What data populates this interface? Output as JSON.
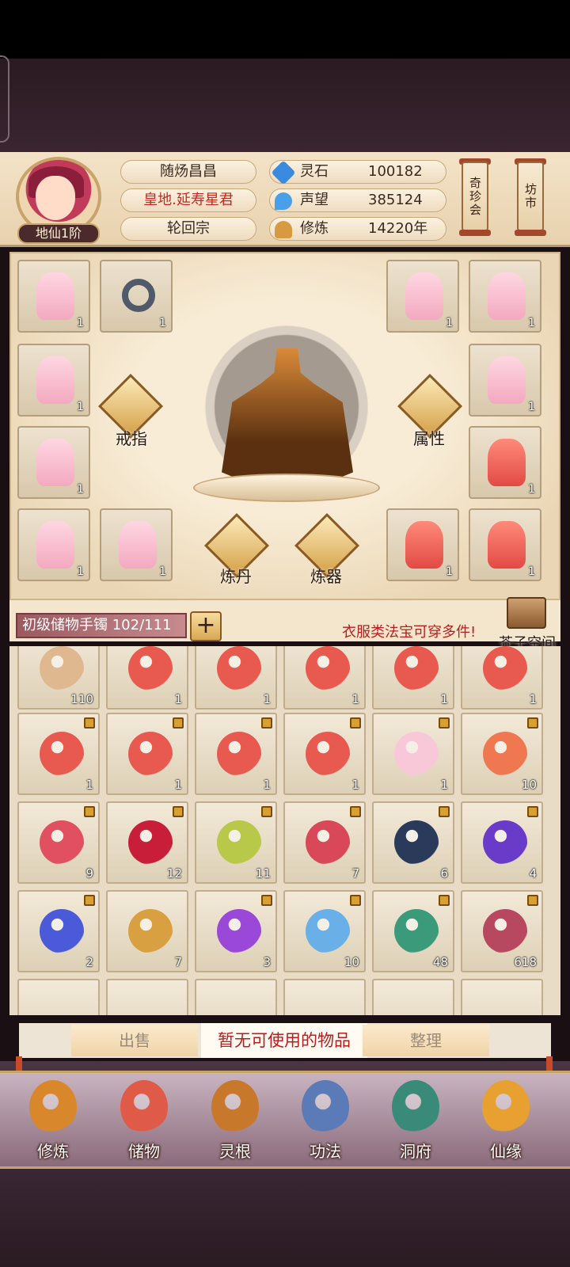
{
  "player": {
    "name": "随炀昌昌",
    "title": "皇地.延寿星君",
    "sect": "轮回宗",
    "rank": "地仙1阶"
  },
  "stats": [
    {
      "label": "灵石",
      "value": "100182",
      "icon": "spirit-stone-icon",
      "color": "#3a8ae0"
    },
    {
      "label": "声望",
      "value": "385124",
      "icon": "prestige-icon",
      "color": "#4aa0e8"
    },
    {
      "label": "修炼",
      "value": "14220年",
      "icon": "meditation-icon",
      "color": "#d89a40"
    }
  ],
  "side_buttons": {
    "treasure_hall": "奇珍会",
    "market": "坊市"
  },
  "equip": {
    "ring_label": "戒指",
    "attr_label": "属性",
    "alchemy_label": "炼丹",
    "forge_label": "炼器",
    "slots": [
      "1",
      "1",
      "1",
      "1",
      "1",
      "1",
      "1",
      "1",
      "1",
      "1",
      "1",
      "1",
      "1",
      "1"
    ]
  },
  "bag": {
    "name": "初级储物手镯 102/111",
    "hint": "衣服类法宝可穿多件!",
    "space_label": "芥子空间"
  },
  "inventory": [
    {
      "count": "110",
      "locked": false,
      "color": "#e0b890"
    },
    {
      "count": "1",
      "locked": false,
      "color": "#e85a50"
    },
    {
      "count": "1",
      "locked": false,
      "color": "#e85a50"
    },
    {
      "count": "1",
      "locked": false,
      "color": "#e85a50"
    },
    {
      "count": "1",
      "locked": false,
      "color": "#e85a50"
    },
    {
      "count": "1",
      "locked": false,
      "color": "#e85a50"
    },
    {
      "count": "1",
      "locked": true,
      "color": "#e85a50"
    },
    {
      "count": "1",
      "locked": true,
      "color": "#e85a50"
    },
    {
      "count": "1",
      "locked": true,
      "color": "#e85a50"
    },
    {
      "count": "1",
      "locked": true,
      "color": "#e85a50"
    },
    {
      "count": "1",
      "locked": true,
      "color": "#f8c8d8"
    },
    {
      "count": "10",
      "locked": true,
      "color": "#f07850"
    },
    {
      "count": "9",
      "locked": true,
      "color": "#e05060"
    },
    {
      "count": "12",
      "locked": true,
      "color": "#c81e3a"
    },
    {
      "count": "11",
      "locked": true,
      "color": "#b8c848"
    },
    {
      "count": "7",
      "locked": true,
      "color": "#d84858"
    },
    {
      "count": "6",
      "locked": true,
      "color": "#2a3a5a"
    },
    {
      "count": "4",
      "locked": true,
      "color": "#6a3ac8"
    },
    {
      "count": "2",
      "locked": true,
      "color": "#4a5ad8"
    },
    {
      "count": "7",
      "locked": false,
      "color": "#d8a040"
    },
    {
      "count": "3",
      "locked": true,
      "color": "#9a48d8"
    },
    {
      "count": "10",
      "locked": true,
      "color": "#6ab0e8"
    },
    {
      "count": "48",
      "locked": true,
      "color": "#3a9a7a"
    },
    {
      "count": "618",
      "locked": true,
      "color": "#b84860"
    }
  ],
  "actions": {
    "sell": "出售",
    "no_items": "暂无可使用的物品",
    "sort": "整理"
  },
  "nav": [
    {
      "label": "修炼",
      "icon": "meditation-icon",
      "color": "#d8882a"
    },
    {
      "label": "储物",
      "icon": "bag-icon",
      "color": "#e05a48"
    },
    {
      "label": "灵根",
      "icon": "spirit-root-icon",
      "color": "#c8782a"
    },
    {
      "label": "功法",
      "icon": "book-icon",
      "color": "#5a7ab8"
    },
    {
      "label": "洞府",
      "icon": "cave-house-icon",
      "color": "#3a8a7a"
    },
    {
      "label": "仙缘",
      "icon": "gourd-icon",
      "color": "#e8a030"
    }
  ]
}
